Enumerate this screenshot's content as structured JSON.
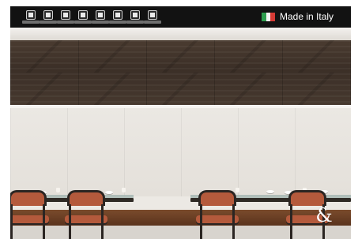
{
  "header": {
    "label": "Made in Italy",
    "flag_colors": [
      "#2e9e4f",
      "#f4f4f4",
      "#d53a34"
    ]
  },
  "toolbar": {
    "icons": [
      "catalog-icon",
      "grid-icon",
      "document-icon",
      "bucket-icon",
      "image-icon",
      "layout-icon",
      "camera-icon",
      "info-icon"
    ]
  },
  "branding": {
    "logo_text": "&"
  },
  "colors": {
    "toolbar_background": "#121212",
    "wood_panel": "#3f3229",
    "wall": "#ebe8e3",
    "chair_upholstery": "#b45a3c",
    "bench": "#6a3d23"
  }
}
